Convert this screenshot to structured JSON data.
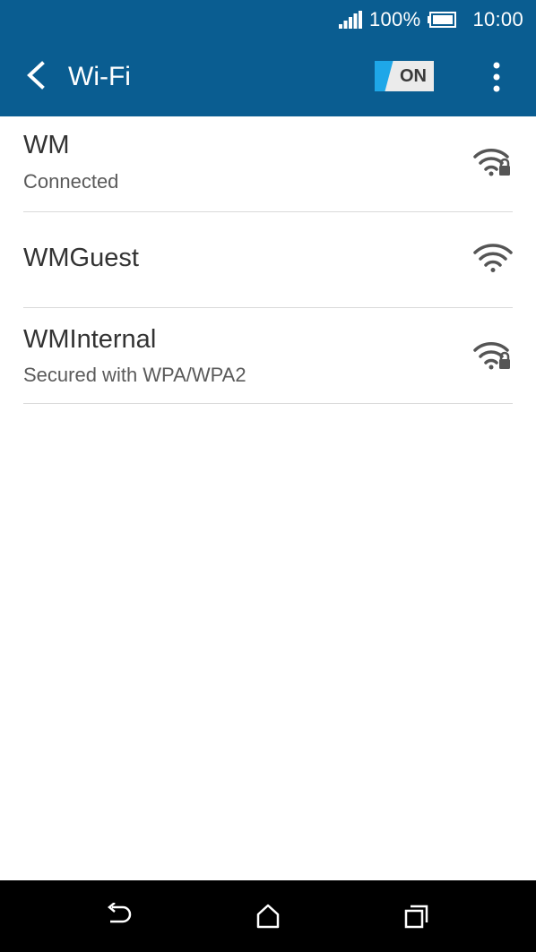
{
  "status_bar": {
    "battery_percent": "100%",
    "time": "10:00",
    "icons": [
      "signal-icon",
      "battery-icon"
    ]
  },
  "app_bar": {
    "title": "Wi-Fi",
    "toggle_label": "ON",
    "icons": [
      "back-arrow-icon",
      "overflow-menu-icon"
    ]
  },
  "networks": [
    {
      "name": "WM",
      "status": "Connected",
      "secured": true
    },
    {
      "name": "WMGuest",
      "status": "",
      "secured": false
    },
    {
      "name": "WMInternal",
      "status": "Secured with WPA/WPA2",
      "secured": true
    }
  ],
  "nav_bar": {
    "icons": [
      "back-icon",
      "home-icon",
      "recent-apps-icon"
    ]
  },
  "colors": {
    "header": "#0a5d91",
    "toggle_accent": "#1ea7e8",
    "toggle_bg": "#ebebeb"
  }
}
